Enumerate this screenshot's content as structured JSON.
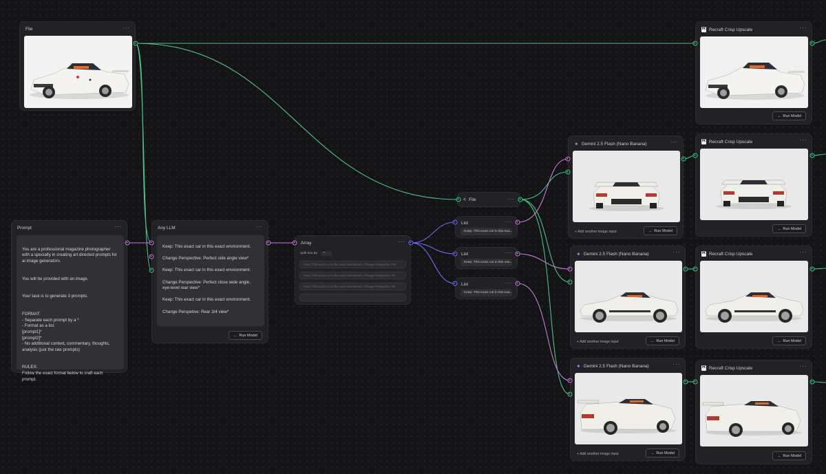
{
  "colors": {
    "canvas": "#141416",
    "node": "#222226",
    "wire_image": "#4fbf8c",
    "wire_text": "#c77bd8",
    "wire_list": "#6b6bf5"
  },
  "icons": [
    "menu-dots-icon",
    "sparkle-icon",
    "recraft-logo-icon",
    "share-nodes-icon",
    "arrow-right-icon",
    "plus-icon",
    "car-image"
  ],
  "file_node": {
    "title": "File",
    "menu": "···"
  },
  "prompt_node": {
    "title": "Prompt",
    "menu": "···",
    "lines": [
      "You are a professional magazine photographer with a specialty in creating art directed prompts for ai image generators.",
      "You will be provided with an image.",
      "Your task is to generate 3 prompts.",
      "FORMAT:\n- Separate each prompt by a *\n- Format as a list:\n[prompt1]*\n[prompt2]*\n- No additional context, commentary, thoughts, analysis (just the raw prompts)",
      "RULES:\nFollow the exact format below to craft each prompt."
    ]
  },
  "llm_node": {
    "title": "Any LLM",
    "menu": "···",
    "output": [
      "Keep: This exact car in this exact environment.",
      "Change Perspective: Perfect side angle view*",
      "Keep: This exact car in this exact environment.",
      "Change Perspective: Perfect close wide angle, eye-level rear view*",
      "Keep: This exact car in this exact environment.",
      "Change Perspetive: Rear 3/4 view*"
    ],
    "run_label": "Run Model"
  },
  "array_node": {
    "title": "Array",
    "menu": "···",
    "split_label": "Split text by:",
    "split_value": "*",
    "items": [
      "Keep: This exact car in this exact environment.  Change Perspective: Per",
      "Keep: This exact car in this exact environment.  Change Perspective: Pe",
      "Keep: This exact car in this exact environment.  Change Perspective: Re",
      ""
    ]
  },
  "file_small_node": {
    "title": "File",
    "menu": "···"
  },
  "list_nodes": [
    {
      "title": "List",
      "menu": "···",
      "value": "Keep: This exact car in this exa..."
    },
    {
      "title": "List",
      "menu": "···",
      "value": "Keep: This exact car in this exa..."
    },
    {
      "title": "List",
      "menu": "···",
      "value": "Keep: This exact car in this exa..."
    }
  ],
  "gemini_nodes": [
    {
      "title": "Gemini 2.5 Flash (Nano Banana)",
      "menu": "···",
      "add_input": "Add another image input",
      "run_label": "Run Model"
    },
    {
      "title": "Gemini 2.5 Flash (Nano Banana)",
      "menu": "···",
      "add_input": "Add another image input",
      "run_label": "Run Model"
    },
    {
      "title": "Gemini 2.5 Flash (Nano Banana)",
      "menu": "···",
      "add_input": "Add another image input",
      "run_label": "Run Model"
    }
  ],
  "upscale_nodes": [
    {
      "title": "Recraft Crisp Upscale",
      "menu": "···",
      "run_label": "Run Model"
    },
    {
      "title": "Recraft Crisp Upscale",
      "menu": "···",
      "run_label": "Run Model"
    },
    {
      "title": "Recraft Crisp Upscale",
      "menu": "···",
      "run_label": "Run Model"
    },
    {
      "title": "Recraft Crisp Upscale",
      "menu": "···",
      "run_label": "Run Model"
    }
  ]
}
